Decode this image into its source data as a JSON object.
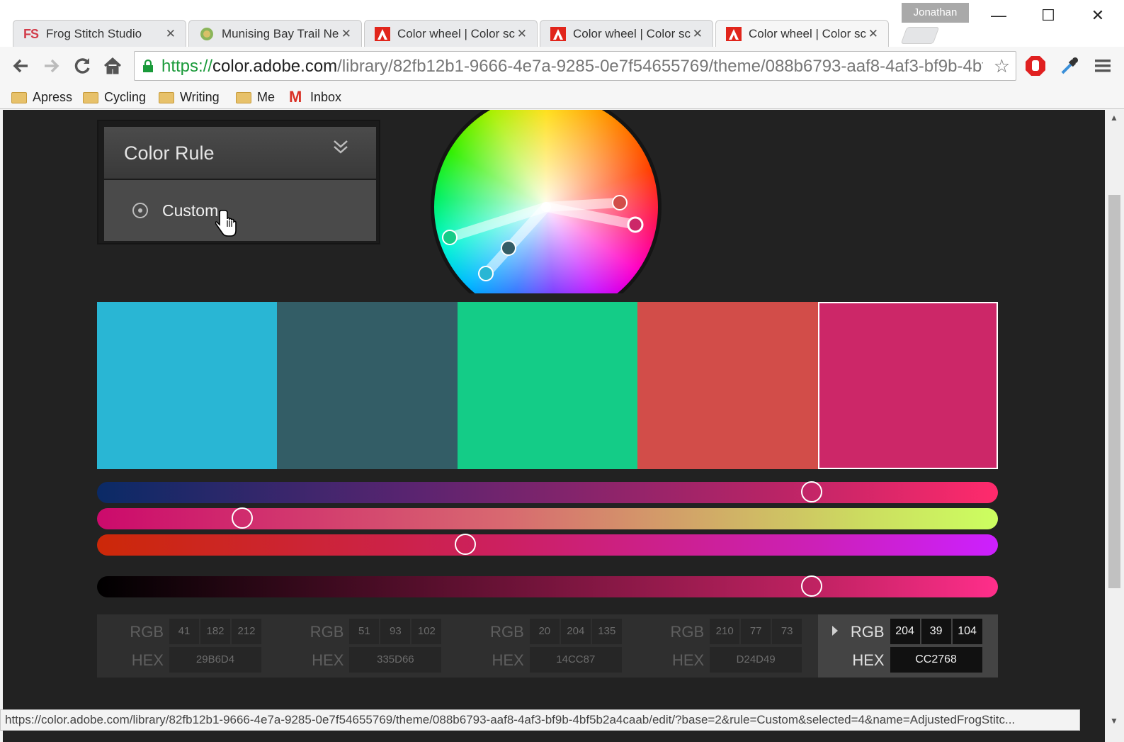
{
  "browser": {
    "profile": "Jonathan",
    "tabs": [
      {
        "title": "Frog Stitch Studio",
        "icon": "fs-logo-icon"
      },
      {
        "title": "Munising Bay Trail Ne",
        "icon": "site-globe-icon"
      },
      {
        "title": "Color wheel | Color sc",
        "icon": "adobe-icon"
      },
      {
        "title": "Color wheel | Color sc",
        "icon": "adobe-icon"
      },
      {
        "title": "Color wheel | Color sc",
        "icon": "adobe-icon",
        "active": true
      }
    ],
    "url": {
      "scheme": "https://",
      "host": "color.adobe.com",
      "path": "/library/82fb12b1-9666-4e7a-9285-0e7f54655769/theme/088b6793-aaf8-4af3-bf9b-4bf5b2a4caab/edit/"
    },
    "bookmarks": [
      {
        "label": "Apress",
        "icon": "folder-icon"
      },
      {
        "label": "Cycling",
        "icon": "folder-icon"
      },
      {
        "label": "Writing",
        "icon": "folder-icon"
      },
      {
        "label": "Me",
        "icon": "folder-icon"
      },
      {
        "label": "Inbox",
        "icon": "gmail-icon"
      }
    ],
    "status_url": "https://color.adobe.com/library/82fb12b1-9666-4e7a-9285-0e7f54655769/theme/088b6793-aaf8-4af3-bf9b-4bf5b2a4caab/edit/?base=2&rule=Custom&selected=4&name=AdjustedFrogStitc..."
  },
  "color_rule": {
    "title": "Color Rule",
    "selected_option": "Custom"
  },
  "palette": {
    "base_index": 2,
    "selected_index": 4,
    "swatches": [
      {
        "hex": "#29B6D4",
        "r": "41",
        "g": "182",
        "b": "212",
        "hex_label": "29B6D4"
      },
      {
        "hex": "#335D66",
        "r": "51",
        "g": "93",
        "b": "102",
        "hex_label": "335D66"
      },
      {
        "hex": "#14CC87",
        "r": "20",
        "g": "204",
        "b": "135",
        "hex_label": "14CC87"
      },
      {
        "hex": "#D24D49",
        "r": "210",
        "g": "77",
        "b": "73",
        "hex_label": "D24D49"
      },
      {
        "hex": "#CC2768",
        "r": "204",
        "g": "39",
        "b": "104",
        "hex_label": "CC2768"
      }
    ]
  },
  "labels": {
    "rgb": "RGB",
    "hex": "HEX"
  },
  "sliders": [
    {
      "name": "red-slider",
      "value": 0.793
    },
    {
      "name": "green-slider",
      "value": 0.161
    },
    {
      "name": "blue-slider",
      "value": 0.409
    },
    {
      "name": "brightness-slider",
      "value": 0.793
    }
  ]
}
